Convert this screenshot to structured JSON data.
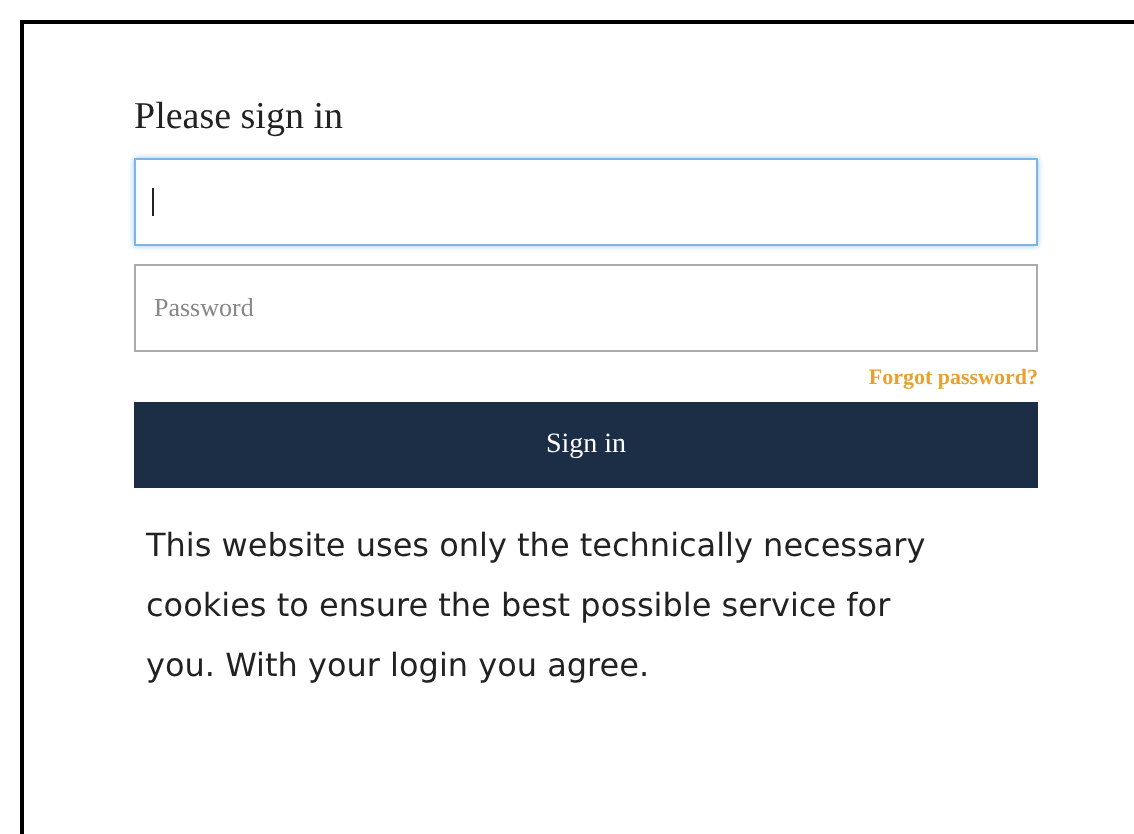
{
  "heading": "Please sign in",
  "fields": [
    {
      "focused": true
    },
    {
      "placeholder": "Password",
      "focused": false
    }
  ],
  "forgot_link": "Forgot password?",
  "submit_button": "Sign in",
  "notice": "This website uses only the technically necessary cookies to ensure the best possible service for you. With your login you agree."
}
